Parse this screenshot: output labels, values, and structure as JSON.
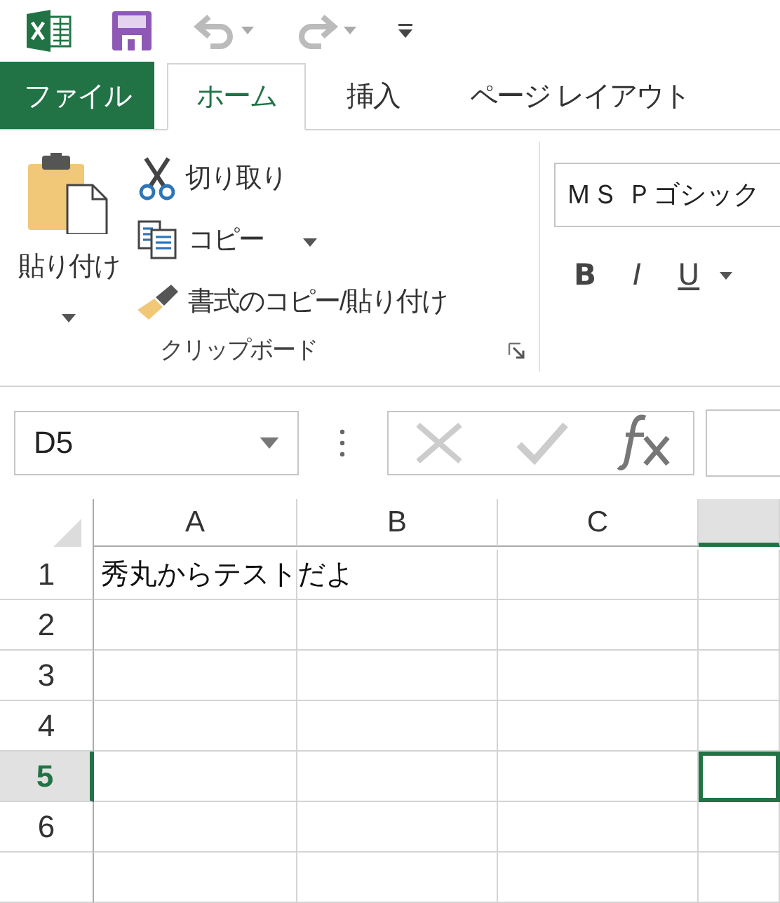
{
  "tabs": [
    {
      "label": "ファイル",
      "kind": "file",
      "selected": false
    },
    {
      "label": "ホーム",
      "kind": "tab",
      "selected": true
    },
    {
      "label": "挿入",
      "kind": "tab",
      "selected": false
    },
    {
      "label": "ページ レイアウト",
      "kind": "tab",
      "selected": false
    }
  ],
  "clipboard": {
    "paste_label": "貼り付け",
    "commands": [
      {
        "label": "切り取り",
        "kind": "cut"
      },
      {
        "label": "コピー",
        "kind": "copy"
      },
      {
        "label": "書式のコピー/貼り付け",
        "kind": "format"
      }
    ],
    "group_label": "クリップボード"
  },
  "font": {
    "name": "ＭＳ Ｐゴシック",
    "styles": [
      {
        "label": "B",
        "kind": "bold"
      },
      {
        "label": "I",
        "kind": "italic"
      },
      {
        "label": "U",
        "kind": "underline"
      }
    ]
  },
  "name_box": "D5",
  "columns": [
    {
      "label": "A",
      "selected": false
    },
    {
      "label": "B",
      "selected": false
    },
    {
      "label": "C",
      "selected": false
    },
    {
      "selected": true
    }
  ],
  "rows": [
    {
      "label": "1",
      "selected": false,
      "text": "秀丸からテストだよ"
    },
    {
      "label": "2",
      "selected": false
    },
    {
      "label": "3",
      "selected": false
    },
    {
      "label": "4",
      "selected": false
    },
    {
      "label": "5",
      "selected": true
    },
    {
      "label": "6",
      "selected": false
    },
    {
      "selected": false
    }
  ]
}
